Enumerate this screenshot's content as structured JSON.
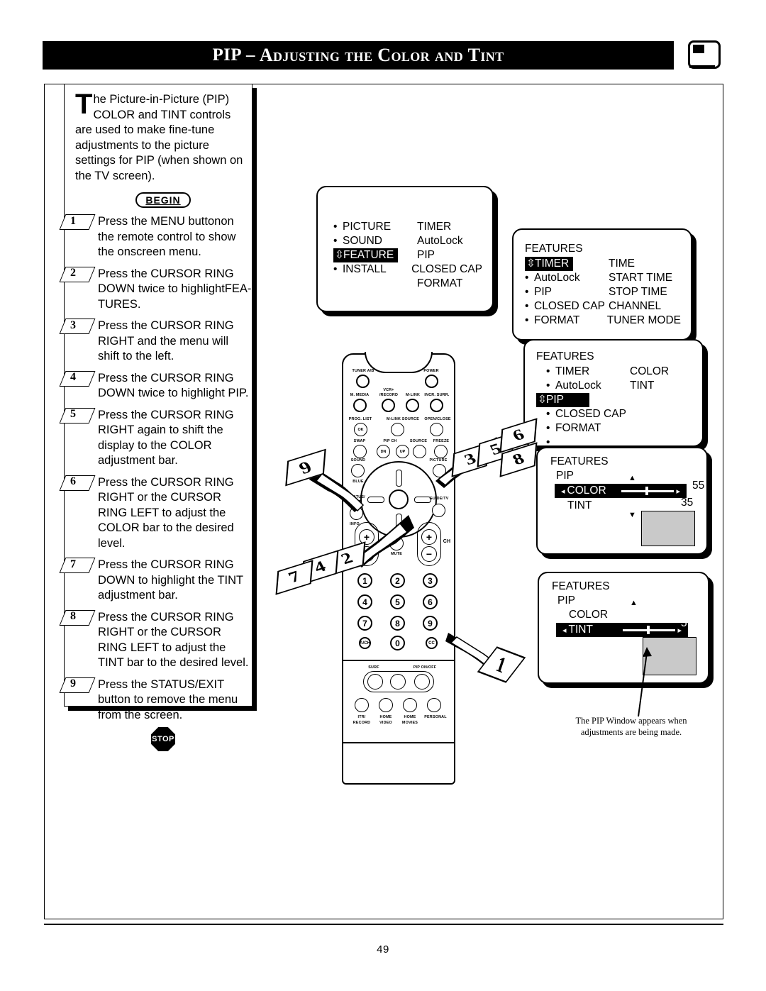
{
  "header": {
    "title_main": "PIP",
    "title_dash": "–",
    "title_rest": "Adjusting the Color and Tint",
    "tv_icon": "tv-pip-icon"
  },
  "intro": {
    "dropcap": "T",
    "text": "he Picture-in-Picture (PIP) COLOR and TINT controls are used to make fine-tune adjustments to the picture settings for PIP (when shown on the TV screen).",
    "begin_label": "BEGIN",
    "stop_label": "STOP"
  },
  "steps": [
    {
      "num": "1",
      "text": "Press the MENU buttonon the remote control to show the onscreen menu."
    },
    {
      "num": "2",
      "text": "Press the CURSOR RING DOWN twice to highlightFEA-TURES."
    },
    {
      "num": "3",
      "text": "Press the CURSOR RING RIGHT  and the menu will shift to the left."
    },
    {
      "num": "4",
      "text": "Press the CURSOR RING DOWN twice to highlight PIP."
    },
    {
      "num": "5",
      "text": "Press the CURSOR RING RIGHT  again to shift the display to the COLOR adjustment bar."
    },
    {
      "num": "6",
      "text": "Press the CURSOR RING RIGHT or the CURSOR RING LEFT  to adjust the COLOR bar to the desired level."
    },
    {
      "num": "7",
      "text": "Press the CURSOR RING DOWN to highlight the TINT adjustment bar."
    },
    {
      "num": "8",
      "text": "Press the CURSOR RING RIGHT or the CURSOR RING LEFT  to adjust the TINT bar to the desired level."
    },
    {
      "num": "9",
      "text": "Press the STATUS/EXIT button to remove the menu from the screen."
    }
  ],
  "menus": {
    "menu1": {
      "left": [
        "PICTURE",
        "SOUND",
        "FEATURE",
        "INSTALL"
      ],
      "right": [
        "TIMER",
        "AutoLock",
        "PIP",
        "CLOSED CAP",
        "FORMAT"
      ],
      "highlighted": "FEATURE"
    },
    "menu2": {
      "title": "FEATURES",
      "left": [
        "TIMER",
        "AutoLock",
        "PIP",
        "CLOSED CAP",
        "FORMAT"
      ],
      "right": [
        "TIME",
        "START TIME",
        "STOP TIME",
        "CHANNEL",
        "TUNER MODE"
      ],
      "highlighted": "TIMER"
    },
    "menu3": {
      "title": "FEATURES",
      "left": [
        "TIMER",
        "AutoLock",
        "PIP",
        "CLOSED CAP",
        "FORMAT",
        ""
      ],
      "right": [
        "COLOR",
        "TINT"
      ],
      "highlighted": "PIP"
    },
    "menu4": {
      "title": "FEATURES",
      "subtitle": "PIP",
      "items": [
        "COLOR",
        "TINT"
      ],
      "highlighted": "COLOR",
      "color_value": "55",
      "tint_value": "35",
      "up_arrow": "▲",
      "down_arrow": "▼",
      "left_arrow": "◂",
      "right_arrow": "▸"
    },
    "menu5": {
      "title": "FEATURES",
      "subtitle": "PIP",
      "items": [
        "COLOR",
        "TINT"
      ],
      "highlighted": "TINT",
      "tint_value": "5",
      "up_arrow": "▲",
      "left_arrow": "◂",
      "right_arrow": "▸"
    }
  },
  "remote": {
    "labels": {
      "tuner_ab": "TUNER A/B",
      "power": "POWER",
      "m_media": "M. MEDIA",
      "vcr_record_1": "VCR+",
      "vcr_record_2": "/RECORD",
      "m_link": "M-LINK",
      "incr_surr": "INCR. SURR.",
      "prog_list": "PROG. LIST",
      "ok": "OK",
      "m_link_source": "M-LINK SOURCE",
      "open_close": "OPEN/CLOSE",
      "swap": "SWAP",
      "pip_ch": "PIP CH",
      "dn": "DN",
      "up": "UP",
      "source": "SOURCE",
      "freeze": "FREEZE",
      "sound": "SOUND",
      "blue": "BLUE",
      "picture": "PICTURE",
      "status_exit_1": "STATUS/",
      "status_exit_2": "EXIT",
      "guide_tv": "GUIDE/TV",
      "info": "INFO",
      "mute": "MUTE",
      "ch": "CH",
      "vol_plus": "+",
      "vol_minus": "−",
      "ch_plus": "+",
      "ch_minus": "−",
      "surf": "SURF",
      "pip_on_off": "PIP ON/OFF",
      "itr_record_1": "ITR/",
      "itr_record_2": "RECORD",
      "home_video_1": "HOME",
      "home_video_2": "VIDEO",
      "home_movies_1": "HOME",
      "home_movies_2": "MOVIES",
      "personal": "PERSONAL"
    },
    "keypad": [
      "1",
      "2",
      "3",
      "4",
      "5",
      "6",
      "7",
      "8",
      "9",
      "A/CH",
      "0",
      "CC"
    ]
  },
  "callouts": [
    "1",
    "2",
    "3",
    "4",
    "5",
    "6",
    "7",
    "8",
    "9"
  ],
  "caption": {
    "line1": "The PIP Window appears when",
    "line2": "adjustments are being made."
  },
  "footer": {
    "page_number": "49"
  }
}
